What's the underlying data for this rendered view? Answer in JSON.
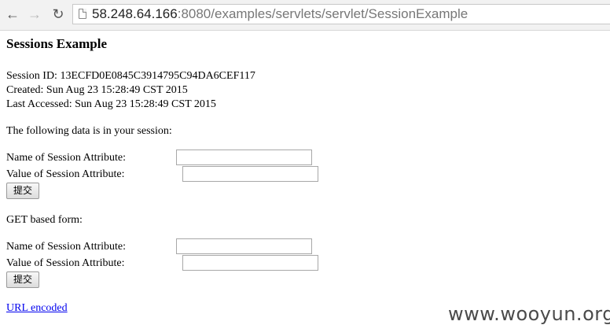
{
  "browser": {
    "url_host": "58.248.64.166",
    "url_rest": ":8080/examples/servlets/servlet/SessionExample",
    "back_icon": "arrow-left",
    "forward_icon": "arrow-right",
    "reload_icon": "reload"
  },
  "page": {
    "title": "Sessions Example",
    "session_id": "Session ID: 13ECFD0E0845C3914795C94DA6CEF117",
    "created": "Created: Sun Aug 23 15:28:49 CST 2015",
    "last_accessed": "Last Accessed: Sun Aug 23 15:28:49 CST 2015",
    "data_intro": "The following data is in your session:",
    "post_form": {
      "name_label": "Name of Session Attribute:",
      "name_value": "",
      "value_label": "Value of Session Attribute:",
      "value_value": "",
      "submit_label": "提交"
    },
    "get_form_heading": "GET based form:",
    "get_form": {
      "name_label": "Name of Session Attribute:",
      "name_value": "",
      "value_label": "Value of Session Attribute:",
      "value_value": "",
      "submit_label": "提交"
    },
    "url_encoded_link": "URL encoded"
  },
  "watermark": "www.wooyun.org"
}
